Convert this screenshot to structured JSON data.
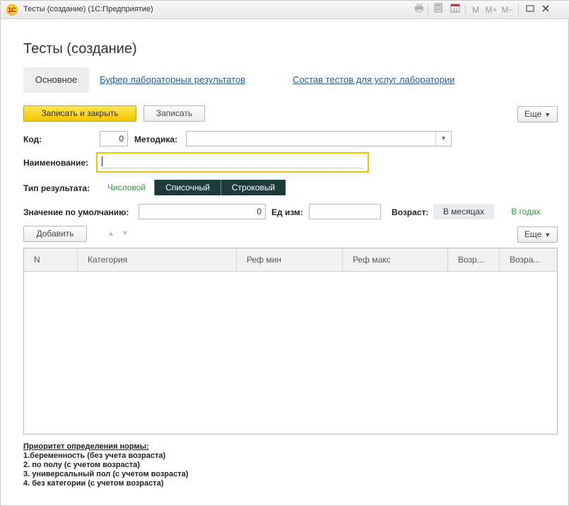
{
  "window": {
    "title": "Тесты (создание)  (1С:Предприятие)",
    "logo_text": "1С",
    "toolbar": {
      "m": "M",
      "m_plus": "M+",
      "m_minus": "M−"
    }
  },
  "page": {
    "title": "Тесты (создание)"
  },
  "tabs": [
    {
      "label": "Основное",
      "active": true
    },
    {
      "label": "Буфер лабораторных результатов",
      "active": false
    },
    {
      "label": "Состав тестов для услуг лаборатории",
      "active": false
    }
  ],
  "actions": {
    "save_close": "Записать и закрыть",
    "save": "Записать",
    "more": "Еще"
  },
  "form": {
    "code_label": "Код:",
    "code_value": "0",
    "method_label": "Методика:",
    "method_value": "",
    "name_label": "Наименование:",
    "name_value": "",
    "result_type_label": "Тип результата:",
    "result_types": [
      "Числовой",
      "Списочный",
      "Строковый"
    ],
    "default_value_label": "Значение по умолчанию:",
    "default_value": "0",
    "unit_label": "Ед изм:",
    "unit_value": "",
    "age_label": "Возраст:",
    "age_options": [
      "В месяцах",
      "В годах"
    ]
  },
  "table": {
    "add_label": "Добавить",
    "more_label": "Еще",
    "columns": [
      "N",
      "Категория",
      "Реф мин",
      "Реф макс",
      "Возр...",
      "Возра..."
    ],
    "rows": []
  },
  "note": {
    "title": "Приоритет определения нормы:",
    "lines": [
      "1.беременность (без учета возраста)",
      "2. по полу (с учетом возраста)",
      "3. универсальный пол (с учетом возраста)",
      "4. без категории (с учетом возраста)"
    ]
  },
  "colors": {
    "accent_yellow": "#f2c800",
    "link_blue": "#2a5c9a",
    "segment_dark": "#1f3a3a",
    "segment_green": "#2f9a3f"
  }
}
